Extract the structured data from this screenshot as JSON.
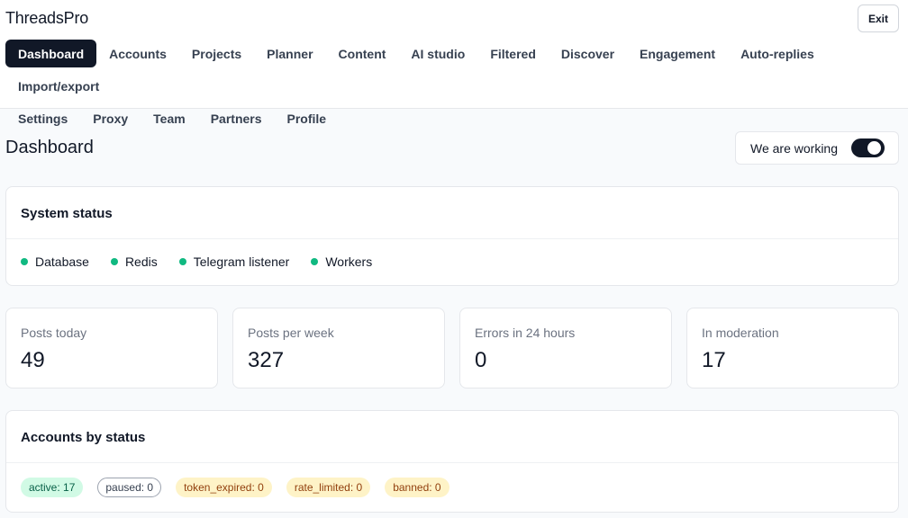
{
  "app": {
    "title": "ThreadsPro",
    "exit_label": "Exit"
  },
  "nav": {
    "row1": [
      "Dashboard",
      "Accounts",
      "Projects",
      "Planner",
      "Content",
      "AI studio",
      "Filtered",
      "Discover",
      "Engagement",
      "Auto-replies",
      "Import/export"
    ],
    "row2": [
      "Settings",
      "Proxy",
      "Team",
      "Partners",
      "Profile"
    ],
    "active": "Dashboard"
  },
  "page": {
    "title": "Dashboard"
  },
  "working": {
    "label": "We are working",
    "enabled": true
  },
  "system_status": {
    "title": "System status",
    "items": [
      "Database",
      "Redis",
      "Telegram listener",
      "Workers"
    ],
    "status_color": "#10b981"
  },
  "stats": [
    {
      "label": "Posts today",
      "value": "49"
    },
    {
      "label": "Posts per week",
      "value": "327"
    },
    {
      "label": "Errors in 24 hours",
      "value": "0"
    },
    {
      "label": "In moderation",
      "value": "17"
    }
  ],
  "accounts_by_status": {
    "title": "Accounts by status",
    "badges": [
      {
        "text": "active: 17",
        "kind": "active"
      },
      {
        "text": "paused: 0",
        "kind": "paused"
      },
      {
        "text": "token_expired: 0",
        "kind": "warn"
      },
      {
        "text": "rate_limited: 0",
        "kind": "warn"
      },
      {
        "text": "banned: 0",
        "kind": "warn"
      }
    ]
  },
  "colors": {
    "accent": "#111827",
    "success": "#10b981",
    "warning_bg": "#fef3c7",
    "active_bg": "#d1fae5"
  }
}
